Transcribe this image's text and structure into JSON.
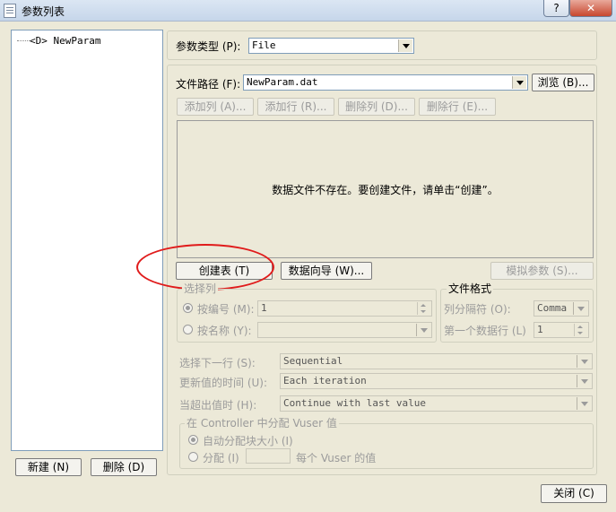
{
  "window": {
    "title": "参数列表",
    "help_label": "?",
    "close_label": "✕"
  },
  "tree": {
    "items": [
      {
        "label": "<D> NewParam"
      }
    ]
  },
  "left_buttons": {
    "new_label": "新建 (N)",
    "delete_label": "删除 (D)"
  },
  "param_type": {
    "label": "参数类型 (P):",
    "value": "File"
  },
  "file_path": {
    "label": "文件路径 (F):",
    "value": "NewParam.dat",
    "browse_label": "浏览 (B)..."
  },
  "toolbar": {
    "add_column": "添加列 (A)...",
    "add_row": "添加行 (R)...",
    "delete_column": "删除列 (D)...",
    "delete_row": "删除行 (E)..."
  },
  "data_area": {
    "message": "数据文件不存在。要创建文件，请单击“创建”。"
  },
  "actions": {
    "create_table": "创建表 (T)",
    "data_wizard": "数据向导 (W)...",
    "simulate_param": "模拟参数 (S)..."
  },
  "select_column": {
    "legend": "选择列",
    "by_number_label": "按编号 (M):",
    "by_number_value": "1",
    "by_name_label": "按名称 (Y):",
    "by_name_value": ""
  },
  "file_format": {
    "legend": "文件格式",
    "delimiter_label": "列分隔符 (O):",
    "delimiter_value": "Comma",
    "first_row_label": "第一个数据行 (L)",
    "first_row_value": "1"
  },
  "options": {
    "select_next_label": "选择下一行 (S):",
    "select_next_value": "Sequential",
    "update_label": "更新值的时间 (U):",
    "update_value": "Each iteration",
    "out_of_values_label": "当超出值时 (H):",
    "out_of_values_value": "Continue with last value"
  },
  "controller": {
    "legend": "在 Controller 中分配 Vuser 值",
    "auto_label": "自动分配块大小 (I)",
    "allocate_label": "分配 (I)",
    "allocate_value": "",
    "per_vuser_label": "每个 Vuser 的值"
  },
  "close_label": "关闭 (C)",
  "colors": {
    "annotation": "#e01b1b"
  }
}
